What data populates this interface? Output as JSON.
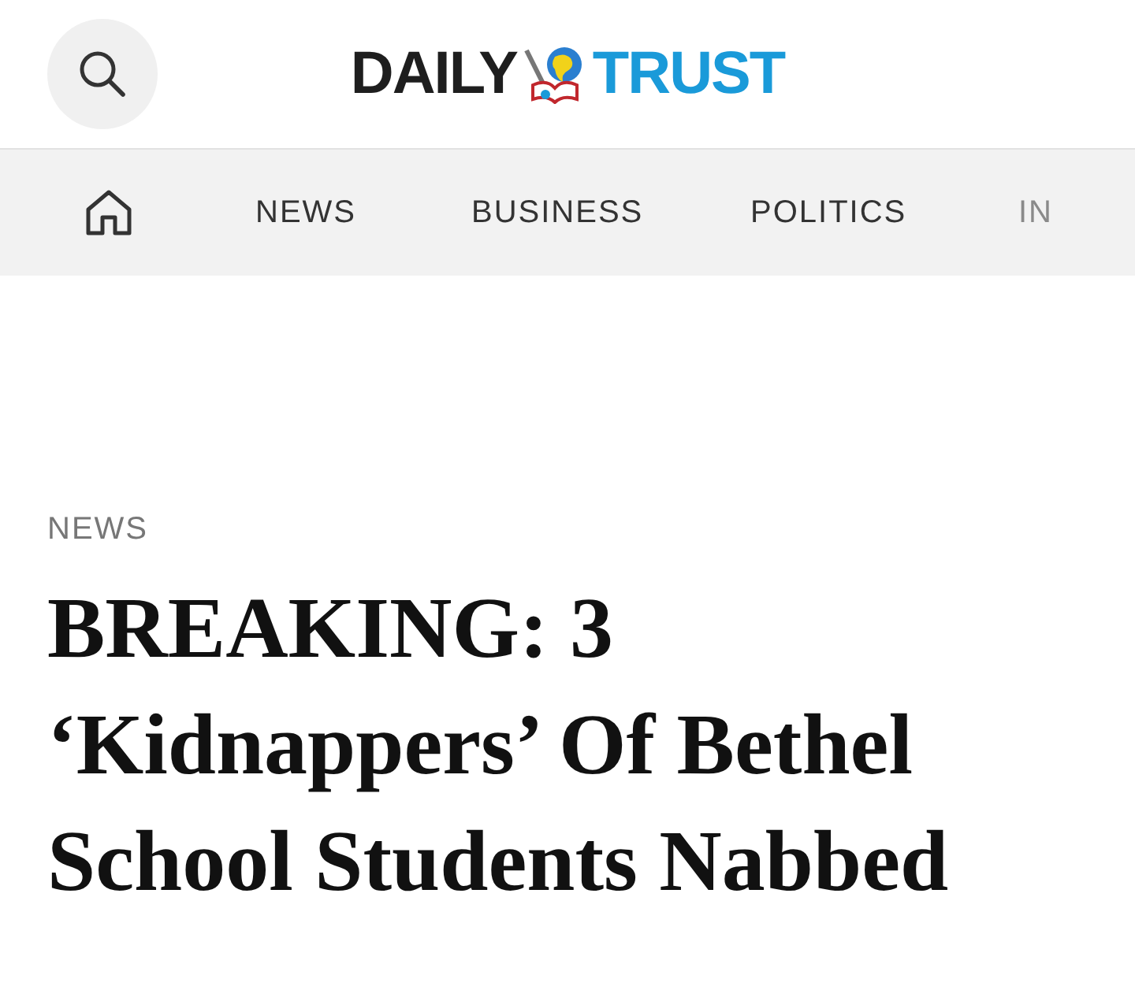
{
  "header": {
    "logo": {
      "left": "DAILY",
      "right": "TRUST"
    }
  },
  "nav": {
    "items": [
      {
        "kind": "home"
      },
      {
        "kind": "link",
        "label": "NEWS"
      },
      {
        "kind": "link",
        "label": "BUSINESS"
      },
      {
        "kind": "link",
        "label": "POLITICS"
      },
      {
        "kind": "faded",
        "label": "IN"
      }
    ]
  },
  "article": {
    "category": "NEWS",
    "headline": "BREAKING: 3 ‘Kidnappers’ Of Bethel School Students Nabbed"
  }
}
